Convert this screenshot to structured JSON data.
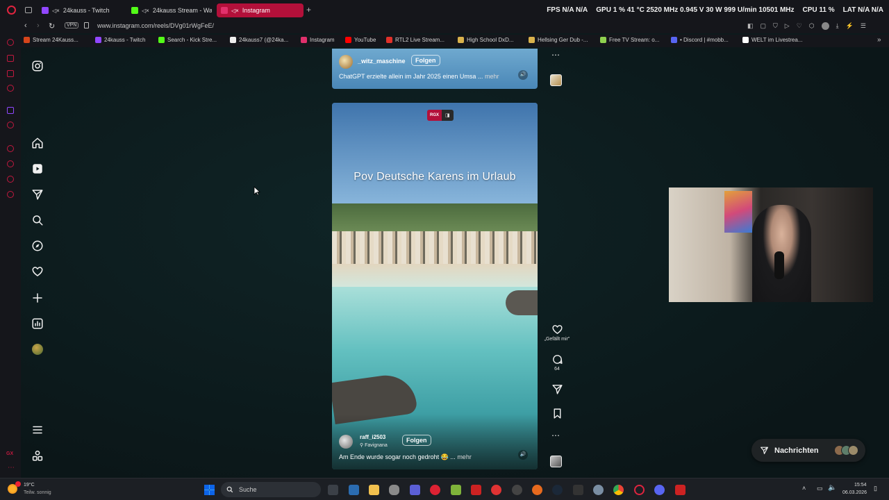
{
  "browser": {
    "tabs": [
      {
        "label": "24kauss - Twitch",
        "color": "#9147ff"
      },
      {
        "label": "24kauss Stream - Wa",
        "color": "#53fc18"
      },
      {
        "label": "Instagram",
        "color": "#e1306c",
        "active": true
      }
    ],
    "new_tab": "+",
    "stats": {
      "fps": "FPS N/A N/A",
      "gpu": "GPU 1 % 41 °C 2520 MHz 0.945 V 30 W 999 U/min 10501 MHz",
      "cpu": "CPU 11 %",
      "lat": "LAT N/A N/A"
    },
    "vpn_label": "VPN",
    "url": "www.instagram.com/reels/DVg01rWgFeE/",
    "bookmarks": [
      {
        "label": "Stream 24Kauss...",
        "color": "#d6451b"
      },
      {
        "label": "24kauss - Twitch",
        "color": "#9147ff"
      },
      {
        "label": "Search - Kick Stre...",
        "color": "#53fc18"
      },
      {
        "label": "24kauss7 (@24ka...",
        "color": "#ffffff"
      },
      {
        "label": "Instagram",
        "color": "#e1306c"
      },
      {
        "label": "YouTube",
        "color": "#ff0000"
      },
      {
        "label": "RTL2 Live Stream...",
        "color": "#e0312a"
      },
      {
        "label": "High School DxD...",
        "color": "#d9b24c"
      },
      {
        "label": "Hellsing Ger Dub -...",
        "color": "#d9b24c"
      },
      {
        "label": "Free TV Stream: o...",
        "color": "#8fd14f"
      },
      {
        "label": "• Discord | #mobb...",
        "color": "#5865f2"
      },
      {
        "label": "WELT im Livestrea...",
        "color": "#ffffff"
      }
    ]
  },
  "reels": {
    "top": {
      "username": "_witz_maschine",
      "follow": "Folgen",
      "caption": "ChatGPT erzielte allein im Jahr 2025 einen Umsa ...",
      "more": "mehr"
    },
    "main": {
      "badge": "RGX",
      "title": "Pov Deutsche Karens im Urlaub",
      "username": "raff_i2503",
      "location": "Favignana",
      "follow": "Folgen",
      "caption": "Am Ende wurde sogar noch gedroht 😂 ...",
      "more": "mehr",
      "likes_label": "„Gefällt mir\"",
      "comments": "64"
    }
  },
  "messages": {
    "label": "Nachrichten"
  },
  "taskbar": {
    "weather_temp": "19°C",
    "weather_desc": "Teilw. sonnig",
    "search": "Suche",
    "time": "15:54",
    "date": "06.03.2026"
  }
}
